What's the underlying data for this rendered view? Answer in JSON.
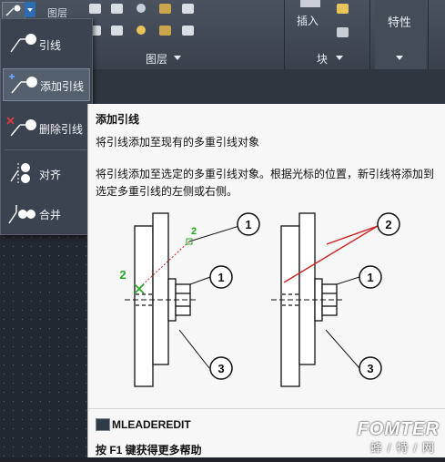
{
  "ribbon": {
    "layer_tab_label": "图层",
    "layer_panel_label": "图层",
    "insert_label": "插入",
    "block_panel_label": "块",
    "properties_label": "特性"
  },
  "dropdown": {
    "items": [
      {
        "label": "引线",
        "icon": "leader-icon"
      },
      {
        "label": "添加引线",
        "icon": "add-leader-icon"
      },
      {
        "label": "删除引线",
        "icon": "remove-leader-icon"
      },
      {
        "label": "对齐",
        "icon": "align-icon"
      },
      {
        "label": "合并",
        "icon": "collect-icon"
      }
    ]
  },
  "tooltip": {
    "title": "添加引线",
    "subtitle": "将引线添加至现有的多重引线对象",
    "description": "将引线添加至选定的多重引线对象。根据光标的位置，新引线将添加到选定多重引线的左侧或右侧。",
    "command": "MLEADEREDIT",
    "help": "按 F1 键获得更多帮助",
    "diagram_left_labels": [
      "1",
      "2",
      "2",
      "1",
      "3"
    ],
    "diagram_right_labels": [
      "2",
      "1",
      "3"
    ],
    "colors": {
      "step_green": "#22aa22",
      "leader_red": "#cc2222"
    }
  },
  "watermark": {
    "main": "FOMTER",
    "sub": "蜂/特/网"
  }
}
